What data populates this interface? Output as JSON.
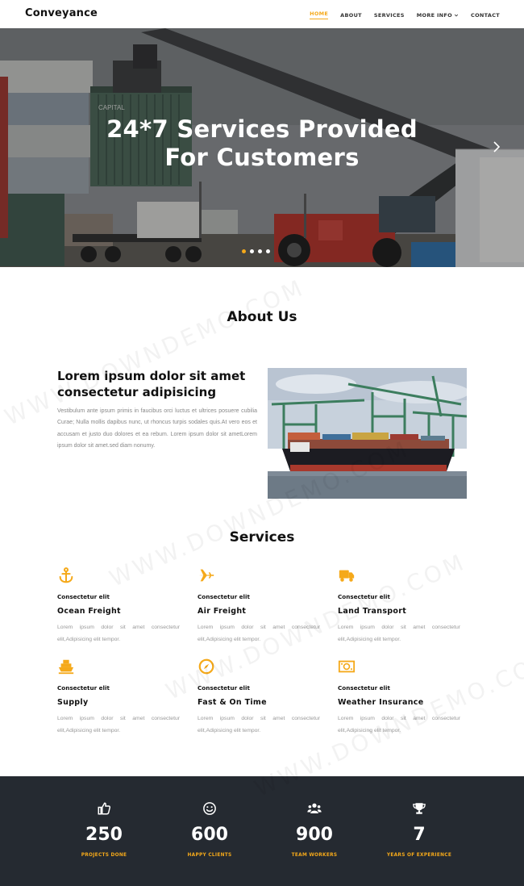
{
  "header": {
    "logo": "Conveyance",
    "nav": [
      {
        "label": "HOME",
        "active": true
      },
      {
        "label": "ABOUT"
      },
      {
        "label": "SERVICES"
      },
      {
        "label": "MORE INFO"
      },
      {
        "label": "CONTACT"
      }
    ]
  },
  "hero": {
    "title_line1": "24*7 Services Provided",
    "title_line2": "For Customers",
    "container_text": "CAPITAL",
    "slides": 4,
    "active_slide": 0
  },
  "about": {
    "title": "About Us",
    "heading": "Lorem ipsum dolor sit amet consectetur adipisicing",
    "text": "Vestibulum ante ipsum primis in faucibus orci luctus et ultrices posuere cubilia Curae; Nulla mollis dapibus nunc, ut rhoncus turpis sodales quis.At vero eos et accusam et justo duo dolores et ea rebum. Lorem ipsum dolor sit ametLorem ipsum dolor sit amet.sed diam nonumy."
  },
  "services": {
    "title": "Services",
    "items": [
      {
        "icon": "anchor-icon",
        "kicker": "Consectetur elit",
        "name": "Ocean Freight",
        "desc": "Lorem ipsum dolor sit amet consectetur elit,Adipisicing elit tempor."
      },
      {
        "icon": "plane-icon",
        "kicker": "Consectetur elit",
        "name": "Air Freight",
        "desc": "Lorem ipsum dolor sit amet consectetur elit,Adipisicing elit tempor."
      },
      {
        "icon": "truck-icon",
        "kicker": "Consectetur elit",
        "name": "Land Transport",
        "desc": "Lorem ipsum dolor sit amet consectetur elit,Adipisicing elit tempor."
      },
      {
        "icon": "ship-icon",
        "kicker": "Consectetur elit",
        "name": "Supply",
        "desc": "Lorem ipsum dolor sit amet consectetur elit,Adipisicing elit tempor."
      },
      {
        "icon": "compass-icon",
        "kicker": "Consectetur elit",
        "name": "Fast & On Time",
        "desc": "Lorem ipsum dolor sit amet consectetur elit,Adipisicing elit tempor."
      },
      {
        "icon": "money-icon",
        "kicker": "Consectetur elit",
        "name": "Weather Insurance",
        "desc": "Lorem ipsum dolor sit amet consectetur elit,Adipisicing elit tempor."
      }
    ]
  },
  "stats": [
    {
      "icon": "thumbs-up-icon",
      "value": "250",
      "label": "PROJECTS DONE"
    },
    {
      "icon": "smile-icon",
      "value": "600",
      "label": "HAPPY CLIENTS"
    },
    {
      "icon": "users-icon",
      "value": "900",
      "label": "TEAM WORKERS"
    },
    {
      "icon": "trophy-icon",
      "value": "7",
      "label": "YEARS OF EXPERIENCE"
    }
  ],
  "watermark": "WWW.DOWNDEMO.COM",
  "colors": {
    "accent": "#f5a91a",
    "dark": "#252a31",
    "text": "#111111",
    "muted": "#999999"
  }
}
